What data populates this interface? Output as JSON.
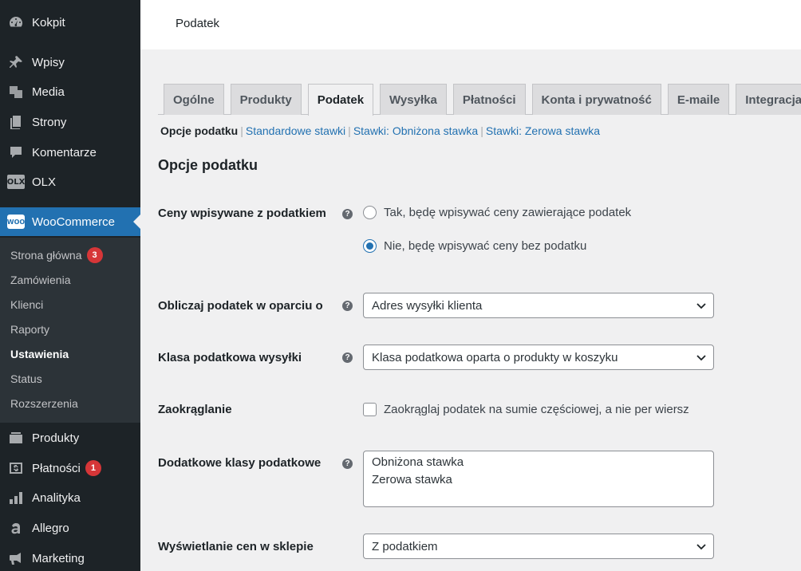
{
  "sidebar": {
    "items": [
      {
        "label": "Kokpit",
        "icon": "dashboard-icon"
      },
      {
        "label": "Wpisy",
        "icon": "pin-icon"
      },
      {
        "label": "Media",
        "icon": "media-icon"
      },
      {
        "label": "Strony",
        "icon": "pages-icon"
      },
      {
        "label": "Komentarze",
        "icon": "comment-icon"
      },
      {
        "label": "OLX",
        "icon": "olx-icon",
        "icon_text": "OLX"
      },
      {
        "label": "WooCommerce",
        "icon": "woo-icon",
        "icon_text": "WOO"
      },
      {
        "label": "Produkty",
        "icon": "products-icon"
      },
      {
        "label": "Płatności",
        "icon": "payments-icon",
        "badge": "1"
      },
      {
        "label": "Analityka",
        "icon": "analytics-icon"
      },
      {
        "label": "Allegro",
        "icon": "allegro-icon"
      },
      {
        "label": "Marketing",
        "icon": "megaphone-icon"
      }
    ],
    "submenu": [
      {
        "label": "Strona główna",
        "badge": "3"
      },
      {
        "label": "Zamówienia"
      },
      {
        "label": "Klienci"
      },
      {
        "label": "Raporty"
      },
      {
        "label": "Ustawienia"
      },
      {
        "label": "Status"
      },
      {
        "label": "Rozszerzenia"
      }
    ]
  },
  "header": {
    "title": "Podatek"
  },
  "tabs": [
    "Ogólne",
    "Produkty",
    "Podatek",
    "Wysyłka",
    "Płatności",
    "Konta i prywatność",
    "E-maile",
    "Integracja"
  ],
  "active_tab": "Podatek",
  "subnav": {
    "current": "Opcje podatku",
    "links": [
      "Standardowe stawki",
      "Stawki: Obniżona stawka",
      "Stawki: Zerowa stawka"
    ]
  },
  "section_title": "Opcje podatku",
  "settings": {
    "prices_entered": {
      "label": "Ceny wpisywane z podatkiem",
      "options": [
        "Tak, będę wpisywać ceny zawierające podatek",
        "Nie, będę wpisywać ceny bez podatku"
      ],
      "selected_index": 1
    },
    "calc_based_on": {
      "label": "Obliczaj podatek w oparciu o",
      "value": "Adres wysyłki klienta"
    },
    "shipping_tax_class": {
      "label": "Klasa podatkowa wysyłki",
      "value": "Klasa podatkowa oparta o produkty w koszyku"
    },
    "rounding": {
      "label": "Zaokrąglanie",
      "checkbox_label": "Zaokrąglaj podatek na sumie częściowej, a nie per wiersz",
      "checked": false
    },
    "additional_classes": {
      "label": "Dodatkowe klasy podatkowe",
      "value": "Obniżona stawka\nZerowa stawka"
    },
    "display_prices_shop": {
      "label": "Wyświetlanie cen w sklepie",
      "value": "Z podatkiem"
    }
  },
  "help_glyph": "?",
  "colors": {
    "accent": "#2271b1",
    "sidebar": "#1d2327",
    "badge": "#d63638"
  }
}
